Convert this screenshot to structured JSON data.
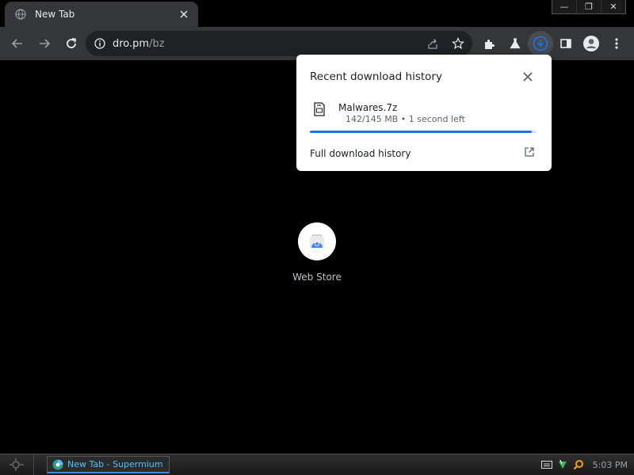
{
  "browser": {
    "tab": {
      "title": "New Tab"
    },
    "window_controls": {
      "minimize": "—",
      "restore": "❐",
      "close": "✕"
    },
    "omnibox": {
      "host": "dro.pm",
      "path": "/bz"
    }
  },
  "download_bubble": {
    "title": "Recent download history",
    "item": {
      "file_name": "Malwares.7z",
      "status": "142/145 MB • 1 second left",
      "progress": 0.98
    },
    "full_history_label": "Full download history"
  },
  "shortcut": {
    "label": "Web Store"
  },
  "taskbar": {
    "task_label": "New Tab - Supermium",
    "clock": "5:03 PM"
  },
  "colors": {
    "accent": "#1a73e8",
    "toolbar": "#35363a",
    "omnibox": "#202124",
    "taskbar_label": "#4fc3ff"
  }
}
